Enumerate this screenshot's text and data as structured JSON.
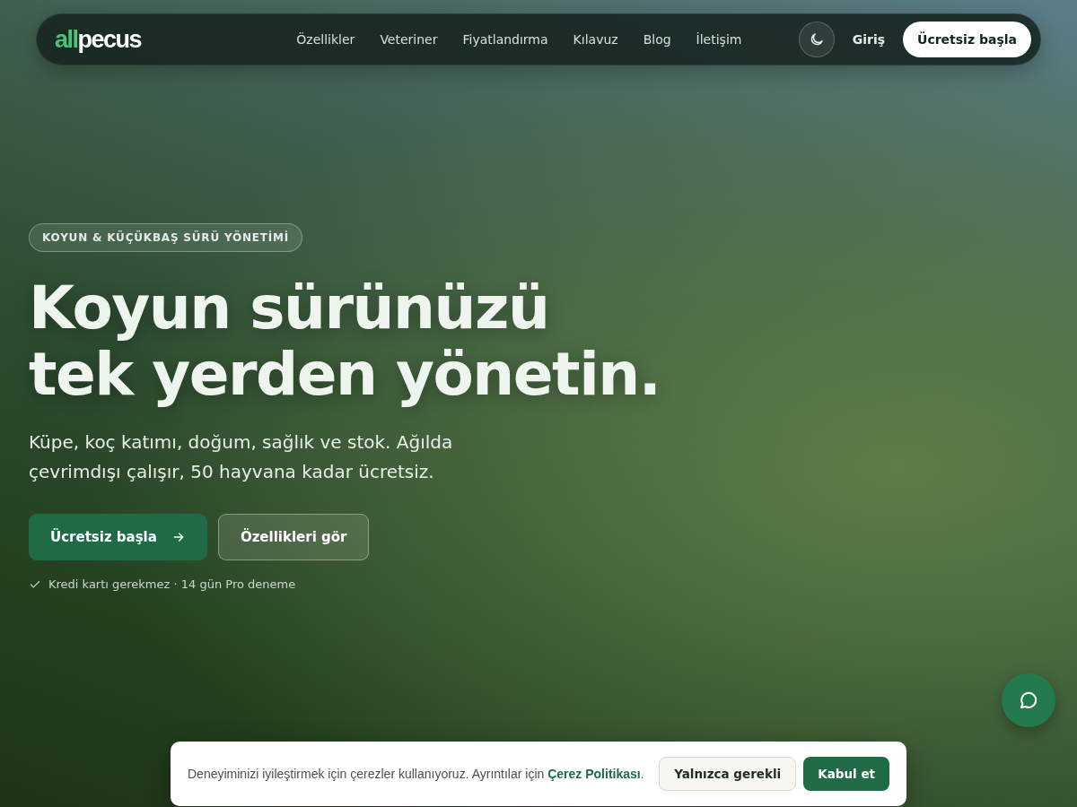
{
  "nav": {
    "logo": {
      "part_1": "all",
      "part_2": "pecus"
    },
    "links": [
      {
        "label": "Özellikler"
      },
      {
        "label": "Veteriner"
      },
      {
        "label": "Fiyatlandırma"
      },
      {
        "label": "Kılavuz"
      },
      {
        "label": "Blog"
      },
      {
        "label": "İletişim"
      }
    ],
    "login": "Giriş",
    "cta": "Ücretsiz başla"
  },
  "hero": {
    "badge": "KOYUN & KÜÇÜKBAŞ SÜRÜ YÖNETİMİ",
    "title_lines": [
      "Koyun sürünüzü",
      "tek yerden yönetin."
    ],
    "subtitle_lines": [
      "Küpe, koç katımı, doğum, sağlık ve stok. Ağılda",
      "çevrimdışı çalışır, 50 hayvana kadar ücretsiz."
    ],
    "buttons": [
      {
        "label": "Ücretsiz başla",
        "kind": "primary"
      },
      {
        "label": "Özellikleri gör",
        "kind": "secondary"
      }
    ],
    "note": "Kredi kartı gerekmez · 14 gün Pro deneme"
  },
  "cookie_banner": {
    "text_before": "Deneyiminizi iyileştirmek için çerezler kullanıyoruz. Ayrıntılar için ",
    "link": "Çerez Politikası",
    "text_after": ".",
    "buttons": [
      {
        "label": "Yalnızca gerekli",
        "kind": "secondary"
      },
      {
        "label": "Kabul et",
        "kind": "primary"
      }
    ]
  }
}
